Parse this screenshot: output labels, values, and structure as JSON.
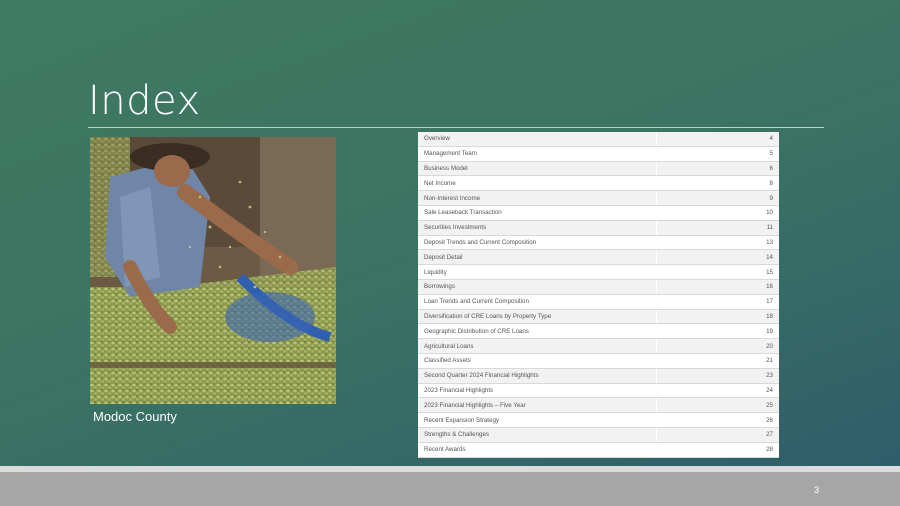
{
  "slide": {
    "title": "Index",
    "caption": "Modoc County",
    "page_number": "3"
  },
  "index": [
    {
      "label": "Overview",
      "page": "4"
    },
    {
      "label": "Management Team",
      "page": "5"
    },
    {
      "label": "Business Model",
      "page": "6"
    },
    {
      "label": "Net Income",
      "page": "8"
    },
    {
      "label": "Non-Interest Income",
      "page": "9"
    },
    {
      "label": "Sale Leaseback Transaction",
      "page": "10"
    },
    {
      "label": "Securities Investments",
      "page": "11"
    },
    {
      "label": "Deposit Trends and Current Composition",
      "page": "13"
    },
    {
      "label": "Deposit Detail",
      "page": "14"
    },
    {
      "label": "Liquidity",
      "page": "15"
    },
    {
      "label": "Borrowings",
      "page": "16"
    },
    {
      "label": "Loan Trends and Current Composition",
      "page": "17"
    },
    {
      "label": "Diversification of CRE Loans by Property Type",
      "page": "18"
    },
    {
      "label": "Geographic Distribution of CRE Loans",
      "page": "19"
    },
    {
      "label": "Agricultural Loans",
      "page": "20"
    },
    {
      "label": "Classified Assets",
      "page": "21"
    },
    {
      "label": "Second Quarter 2024 Financial Highlights",
      "page": "23"
    },
    {
      "label": "2023 Financial Highlights",
      "page": "24"
    },
    {
      "label": "2023 Financial Highlights – Five Year",
      "page": "25"
    },
    {
      "label": "Recent Expansion Strategy",
      "page": "26"
    },
    {
      "label": "Strengths & Challenges",
      "page": "27"
    },
    {
      "label": "Recent Awards",
      "page": "28"
    }
  ]
}
